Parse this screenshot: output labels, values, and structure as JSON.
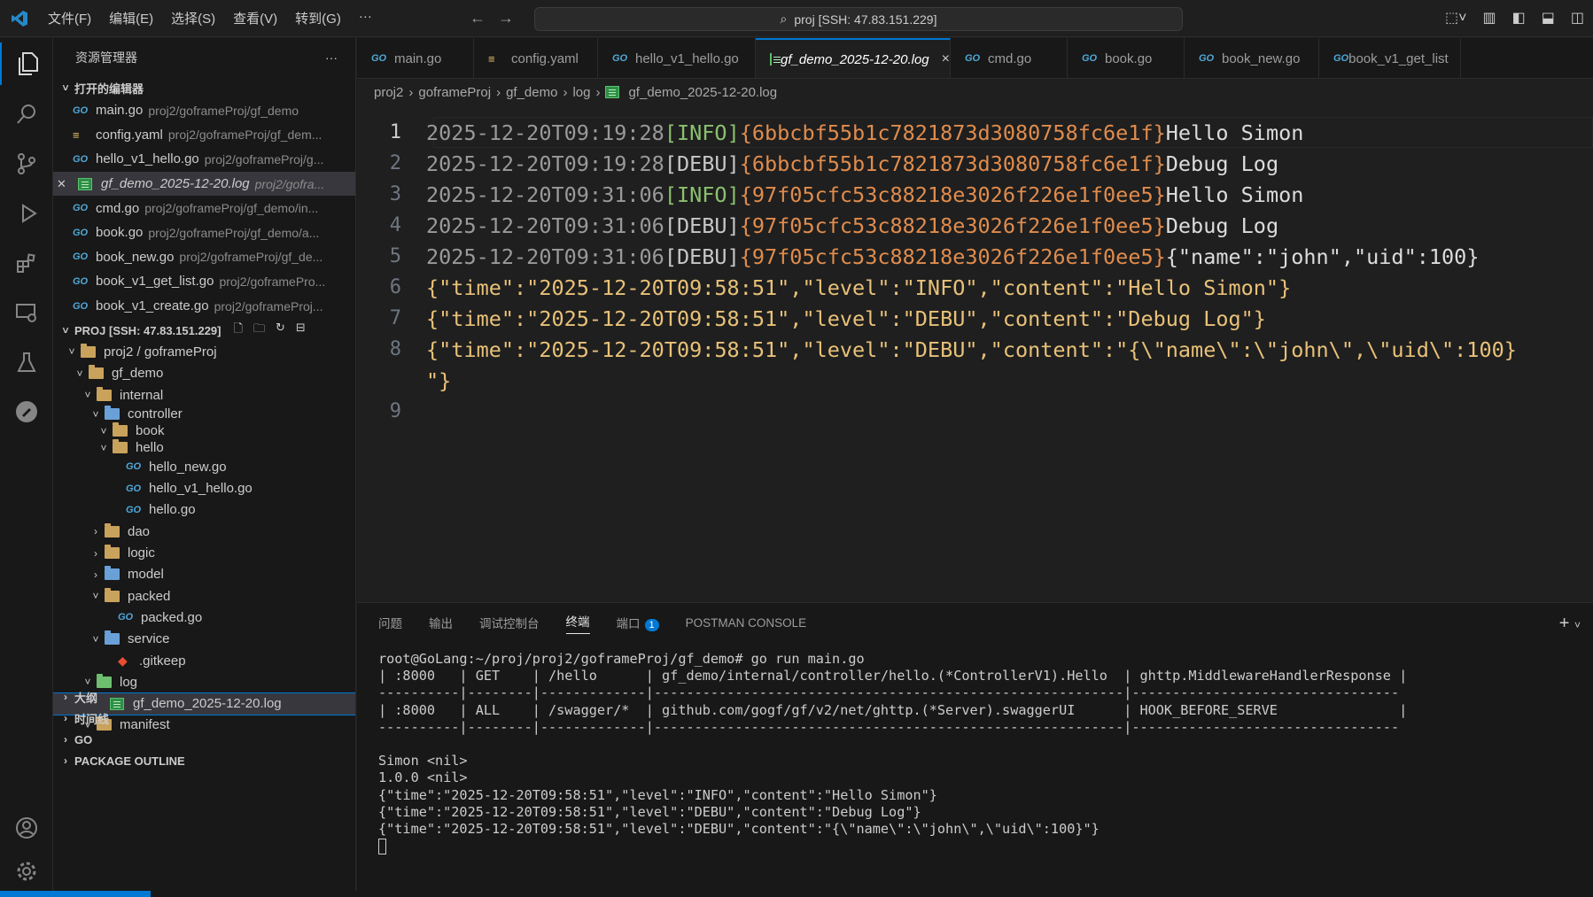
{
  "titlebar": {
    "menu": [
      "文件(F)",
      "编辑(E)",
      "选择(S)",
      "查看(V)",
      "转到(G)",
      "···"
    ],
    "search": "proj [SSH: 47.83.151.229]"
  },
  "sidebar": {
    "title": "资源管理器",
    "more": "···",
    "open_editors_label": "打开的编辑器",
    "open_editors": [
      {
        "name": "main.go",
        "path": "proj2/goframeProj/gf_demo",
        "type": "go"
      },
      {
        "name": "config.yaml",
        "path": "proj2/goframeProj/gf_dem...",
        "type": "yaml"
      },
      {
        "name": "hello_v1_hello.go",
        "path": "proj2/goframeProj/g...",
        "type": "go"
      },
      {
        "name": "gf_demo_2025-12-20.log",
        "path": "proj2/gofra...",
        "type": "log"
      },
      {
        "name": "cmd.go",
        "path": "proj2/goframeProj/gf_demo/in...",
        "type": "go"
      },
      {
        "name": "book.go",
        "path": "proj2/goframeProj/gf_demo/a...",
        "type": "go"
      },
      {
        "name": "book_new.go",
        "path": "proj2/goframeProj/gf_de...",
        "type": "go"
      },
      {
        "name": "book_v1_get_list.go",
        "path": "proj2/goframePro...",
        "type": "go"
      },
      {
        "name": "book_v1_create.go",
        "path": "proj2/goframeProj...",
        "type": "go"
      }
    ],
    "workspace_label": "PROJ [SSH: 47.83.151.229]",
    "tree": [
      {
        "label": "proj2 / goframeProj",
        "kind": "folder",
        "chev": "v"
      },
      {
        "label": "gf_demo",
        "kind": "folder",
        "chev": "v"
      },
      {
        "label": "internal",
        "kind": "folder",
        "chev": "v"
      },
      {
        "label": "controller",
        "kind": "folder-blue",
        "chev": "v"
      },
      {
        "label": "book",
        "kind": "folder",
        "chev": "v"
      },
      {
        "label": "hello",
        "kind": "folder",
        "chev": "v"
      },
      {
        "label": "hello_new.go",
        "kind": "go"
      },
      {
        "label": "hello_v1_hello.go",
        "kind": "go"
      },
      {
        "label": "hello.go",
        "kind": "go"
      },
      {
        "label": "dao",
        "kind": "folder",
        "chev": ">"
      },
      {
        "label": "logic",
        "kind": "folder",
        "chev": ">"
      },
      {
        "label": "model",
        "kind": "folder-blue",
        "chev": ">"
      },
      {
        "label": "packed",
        "kind": "folder",
        "chev": "v"
      },
      {
        "label": "packed.go",
        "kind": "go"
      },
      {
        "label": "service",
        "kind": "folder-blue",
        "chev": "v"
      },
      {
        "label": ".gitkeep",
        "kind": "git"
      },
      {
        "label": "log",
        "kind": "folder-green",
        "chev": "v"
      },
      {
        "label": "gf_demo_2025-12-20.log",
        "kind": "log"
      },
      {
        "label": "manifest",
        "kind": "folder",
        "chev": "v"
      }
    ],
    "bottom_sections": [
      "大纲",
      "时间线",
      "GO",
      "PACKAGE OUTLINE"
    ]
  },
  "tabs": [
    {
      "label": "main.go",
      "type": "go"
    },
    {
      "label": "config.yaml",
      "type": "yaml"
    },
    {
      "label": "hello_v1_hello.go",
      "type": "go"
    },
    {
      "label": "gf_demo_2025-12-20.log",
      "type": "log",
      "active": true,
      "close": "×"
    },
    {
      "label": "cmd.go",
      "type": "go"
    },
    {
      "label": "book.go",
      "type": "go"
    },
    {
      "label": "book_new.go",
      "type": "go"
    },
    {
      "label": "book_v1_get_list",
      "type": "go"
    }
  ],
  "breadcrumb": [
    "proj2",
    "goframeProj",
    "gf_demo",
    "log",
    "gf_demo_2025-12-20.log"
  ],
  "code": {
    "line_numbers": [
      "1",
      "2",
      "3",
      "4",
      "5",
      "6",
      "7",
      "8",
      "9"
    ],
    "lines": [
      {
        "date": "2025-12-20T09:19:28",
        "level": "[INFO]",
        "hash": "{6bbcbf55b1c7821873d3080758fc6e1f}",
        "msg": "Hello Simon"
      },
      {
        "date": "2025-12-20T09:19:28",
        "level": "[DEBU]",
        "hash": "{6bbcbf55b1c7821873d3080758fc6e1f}",
        "msg": "Debug Log"
      },
      {
        "date": "2025-12-20T09:31:06",
        "level": "[INFO]",
        "hash": "{97f05cfc53c88218e3026f226e1f0ee5}",
        "msg": "Hello Simon"
      },
      {
        "date": "2025-12-20T09:31:06",
        "level": "[DEBU]",
        "hash": "{97f05cfc53c88218e3026f226e1f0ee5}",
        "msg": "Debug Log"
      },
      {
        "date": "2025-12-20T09:31:06",
        "level": "[DEBU]",
        "hash": "{97f05cfc53c88218e3026f226e1f0ee5}",
        "msg": "{\"name\":\"john\",\"uid\":100}"
      }
    ],
    "json_lines": [
      "{\"time\":\"2025-12-20T09:58:51\",\"level\":\"INFO\",\"content\":\"Hello Simon\"}",
      "{\"time\":\"2025-12-20T09:58:51\",\"level\":\"DEBU\",\"content\":\"Debug Log\"}",
      "{\"time\":\"2025-12-20T09:58:51\",\"level\":\"DEBU\",\"content\":\"{\\\"name\\\":\\\"john\\\",\\\"uid\\\":100}",
      "\"}"
    ]
  },
  "panel": {
    "tabs": [
      "问题",
      "输出",
      "调试控制台",
      "终端",
      "端口",
      "POSTMAN CONSOLE"
    ],
    "active_tab": "终端",
    "ports_badge": "1",
    "add": "+",
    "terminal_lines": [
      "root@GoLang:~/proj/proj2/goframeProj/gf_demo# go run main.go",
      "| :8000   | GET    | /hello      | gf_demo/internal/controller/hello.(*ControllerV1).Hello  | ghttp.MiddlewareHandlerResponse |",
      "----------|--------|-------------|----------------------------------------------------------|---------------------------------",
      "| :8000   | ALL    | /swagger/*  | github.com/gogf/gf/v2/net/ghttp.(*Server).swaggerUI      | HOOK_BEFORE_SERVE               |",
      "----------|--------|-------------|----------------------------------------------------------|---------------------------------",
      "",
      "Simon <nil>",
      "1.0.0 <nil>",
      "{\"time\":\"2025-12-20T09:58:51\",\"level\":\"INFO\",\"content\":\"Hello Simon\"}",
      "{\"time\":\"2025-12-20T09:58:51\",\"level\":\"DEBU\",\"content\":\"Debug Log\"}",
      "{\"time\":\"2025-12-20T09:58:51\",\"level\":\"DEBU\",\"content\":\"{\\\"name\\\":\\\"john\\\",\\\"uid\\\":100}\"}"
    ]
  },
  "colors": {
    "accent": "#0078d4",
    "go_icon": "#4fa8d8",
    "info": "#8bc070",
    "hash": "#e08c4d"
  }
}
